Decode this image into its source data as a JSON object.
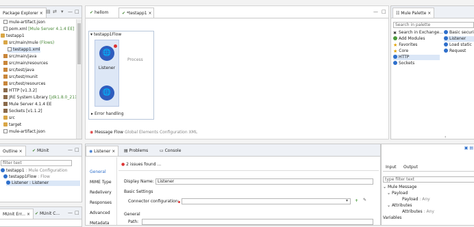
{
  "package_explorer": {
    "tab_label": "Package Explorer",
    "tree": [
      {
        "label": "mule-artifact.json",
        "icon": "file"
      },
      {
        "label": "pom.xml",
        "suffix": " [Mule Server 4.1.4 EE]",
        "icon": "file"
      },
      {
        "label": "testapp1",
        "icon": "folder"
      },
      {
        "label": "src/main/mule",
        "suffix": " (Flows)",
        "icon": "folder"
      },
      {
        "label": "testapp1.xml",
        "icon": "file",
        "selected": true
      },
      {
        "label": "src/main/java",
        "icon": "pkg"
      },
      {
        "label": "src/main/resources",
        "icon": "pkg"
      },
      {
        "label": "src/test/java",
        "icon": "pkg"
      },
      {
        "label": "src/test/munit",
        "icon": "pkg"
      },
      {
        "label": "src/test/resources",
        "icon": "pkg"
      },
      {
        "label": "HTTP [v1.3.2]",
        "icon": "lib"
      },
      {
        "label": "JRE System Library",
        "suffix": " [jdk1.8.0_211]",
        "icon": "lib"
      },
      {
        "label": "Mule Server 4.1.4 EE",
        "icon": "lib"
      },
      {
        "label": "Sockets [v1.1.2]",
        "icon": "lib"
      },
      {
        "label": "src",
        "icon": "folder"
      },
      {
        "label": "target",
        "icon": "folder"
      },
      {
        "label": "mule-artifact.json",
        "icon": "file"
      }
    ]
  },
  "editor": {
    "tabs": [
      {
        "label": "hellom",
        "active": false
      },
      {
        "label": "*testapp1",
        "active": true
      }
    ],
    "flow_name": "testapp1Flow",
    "listener_label": "Listener",
    "process_label": "Process",
    "error_handling_label": "Error handling",
    "bottom_tabs": [
      "Message Flow",
      "Global Elements",
      "Configuration XML"
    ]
  },
  "mule_palette": {
    "tab_label": "Mule Palette",
    "search_placeholder": "Search in palette",
    "left_items": [
      "Search in Exchange...",
      "Add Modules",
      "Favorites",
      "Core",
      "HTTP",
      "Sockets"
    ],
    "right_items": [
      "Basic securi",
      "Listener",
      "Load static",
      "Request"
    ]
  },
  "outline": {
    "tabs": [
      "Outline",
      "MUnit"
    ],
    "filter_placeholder": "filter text",
    "tree": [
      {
        "label": "testapp1",
        "suffix": " : Mule Configuration"
      },
      {
        "label": "testapp1Flow",
        "suffix": " : Flow"
      },
      {
        "label": "Listener : Listener",
        "suffix": ""
      }
    ]
  },
  "munit_bottom": {
    "tabs": [
      "MUnit Err...",
      "MUnit C..."
    ]
  },
  "properties": {
    "tabs": [
      "Listener",
      "Problems",
      "Console"
    ],
    "side_nav": [
      "General",
      "MIME Type",
      "Redelivery",
      "Responses",
      "Advanced",
      "Metadata"
    ],
    "issues": "2 issues found ...",
    "display_name_label": "Display Name:",
    "display_name_value": "Listener",
    "basic_settings_label": "Basic Settings",
    "connector_config_label": "Connector configuration:",
    "general_label": "General",
    "path_label": "Path:"
  },
  "metadata": {
    "tabs": [
      "Input",
      "Output"
    ],
    "filter_placeholder": "type filter text",
    "tree": [
      {
        "label": "Mule Message",
        "indent": 0
      },
      {
        "label": "Payload",
        "indent": 1
      },
      {
        "label": "Payload",
        "type": "Any",
        "indent": 2
      },
      {
        "label": "Attributes",
        "indent": 1
      },
      {
        "label": "Attributes",
        "type": "Any",
        "indent": 2
      },
      {
        "label": "Variables",
        "indent": 0
      }
    ]
  },
  "colors": {
    "accent": "#2e6fcb",
    "error": "#d33",
    "highlight": "#dbe7f7"
  }
}
